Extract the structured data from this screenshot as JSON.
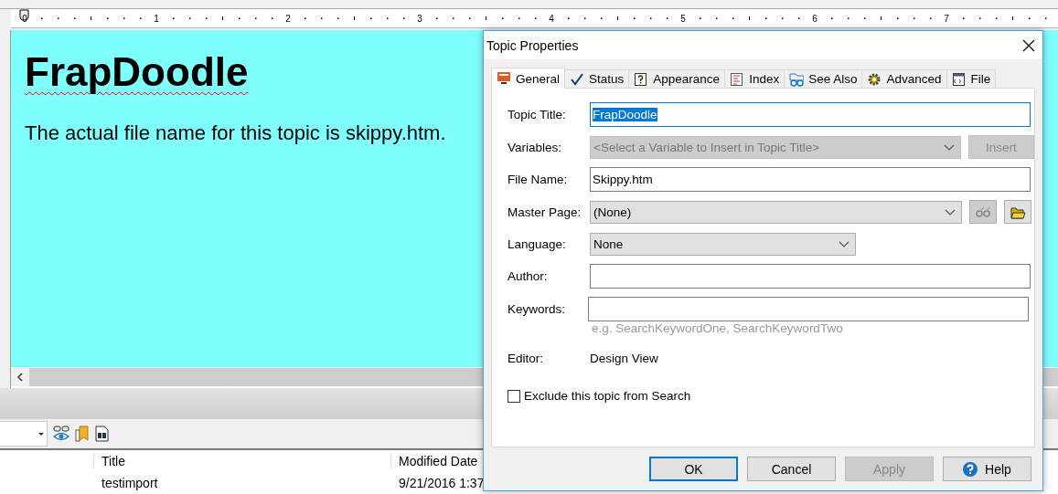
{
  "ruler": {
    "numbers": [
      "0",
      "1",
      "2",
      "3",
      "4",
      "5",
      "6",
      "7"
    ]
  },
  "editor": {
    "heading": "FrapDoodle",
    "paragraph": "The actual file name for this topic is skippy.htm."
  },
  "table": {
    "columns": [
      "Title",
      "Modified Date"
    ],
    "rows": [
      [
        "testimport",
        "9/21/2016 1:37"
      ]
    ]
  },
  "dialog": {
    "title": "Topic Properties",
    "tabs": [
      {
        "label": "General",
        "selected": true
      },
      {
        "label": "Status",
        "selected": false
      },
      {
        "label": "Appearance",
        "selected": false
      },
      {
        "label": "Index",
        "selected": false
      },
      {
        "label": "See Also",
        "selected": false
      },
      {
        "label": "Advanced",
        "selected": false
      },
      {
        "label": "File",
        "selected": false
      }
    ],
    "fields": [
      {
        "kind": "text",
        "label": "Topic Title:",
        "value": "FrapDoodle",
        "highlighted": true,
        "focused": true
      },
      {
        "kind": "dropdown",
        "label": "Variables:",
        "value": "<Select a Variable to Insert in Topic Title>",
        "disabled": true,
        "button": {
          "label": "Insert",
          "disabled": true
        }
      },
      {
        "kind": "text",
        "label": "File Name:",
        "value": "Skippy.htm"
      },
      {
        "kind": "dropdown",
        "label": "Master Page:",
        "value": "(None)",
        "disabled": false,
        "icon_buttons": [
          {
            "disabled": true
          },
          {
            "disabled": false
          }
        ]
      },
      {
        "kind": "dropdown",
        "label": "Language:",
        "value": "None",
        "disabled": false
      },
      {
        "kind": "text",
        "label": "Author:"
      },
      {
        "kind": "text",
        "label": "Keywords:",
        "hint": "e.g. SearchKeywordOne, SearchKeywordTwo"
      },
      {
        "kind": "static",
        "label": "Editor:",
        "value": "Design View"
      },
      {
        "kind": "checkbox",
        "label": "Exclude this topic from Search",
        "checked": false
      }
    ],
    "buttons": [
      {
        "label": "OK",
        "default": true,
        "disabled": false
      },
      {
        "label": "Cancel",
        "default": false,
        "disabled": false
      },
      {
        "label": "Apply",
        "default": false,
        "disabled": true
      },
      {
        "kind": "help",
        "label": "Help",
        "default": false,
        "disabled": false
      }
    ]
  }
}
